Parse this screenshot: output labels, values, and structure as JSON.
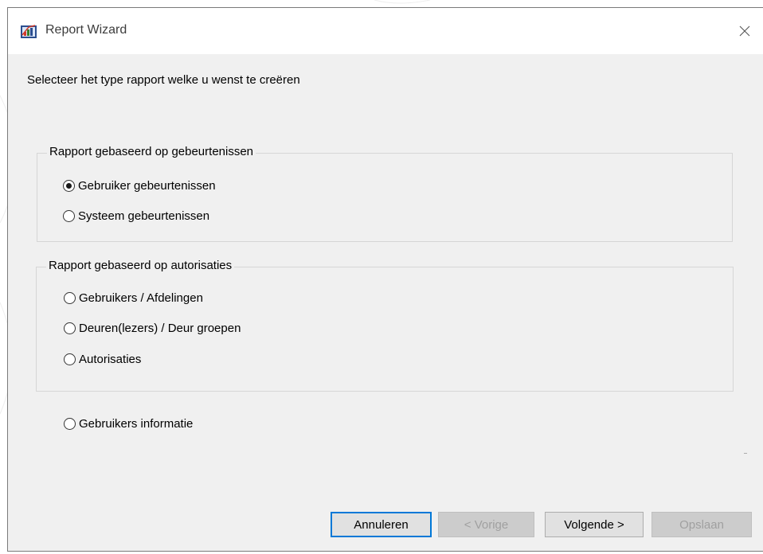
{
  "window": {
    "title": "Report Wizard",
    "icon": "report-wizard-icon",
    "close_icon": "close-icon"
  },
  "instruction": "Selecteer het type rapport welke u wenst te creëren",
  "groups": [
    {
      "legend": "Rapport gebaseerd op gebeurtenissen",
      "options": [
        {
          "label": "Gebruiker gebeurtenissen",
          "selected": true
        },
        {
          "label": "Systeem gebeurtenissen",
          "selected": false
        }
      ]
    },
    {
      "legend": "Rapport gebaseerd op autorisaties",
      "options": [
        {
          "label": "Gebruikers / Afdelingen",
          "selected": false
        },
        {
          "label": "Deuren(lezers) / Deur groepen",
          "selected": false
        },
        {
          "label": "Autorisaties",
          "selected": false
        }
      ]
    }
  ],
  "standalone_option": {
    "label": "Gebruikers informatie",
    "selected": false
  },
  "buttons": {
    "cancel": {
      "label": "Annuleren",
      "enabled": true
    },
    "previous": {
      "label": "< Vorige",
      "enabled": false
    },
    "next": {
      "label": "Volgende >",
      "enabled": true
    },
    "save": {
      "label": "Opslaan",
      "enabled": false
    }
  },
  "colors": {
    "window_bg": "#f0f0f0",
    "titlebar_bg": "#ffffff",
    "focus_border": "#0078d7",
    "disabled_text": "#a0a0a0"
  }
}
